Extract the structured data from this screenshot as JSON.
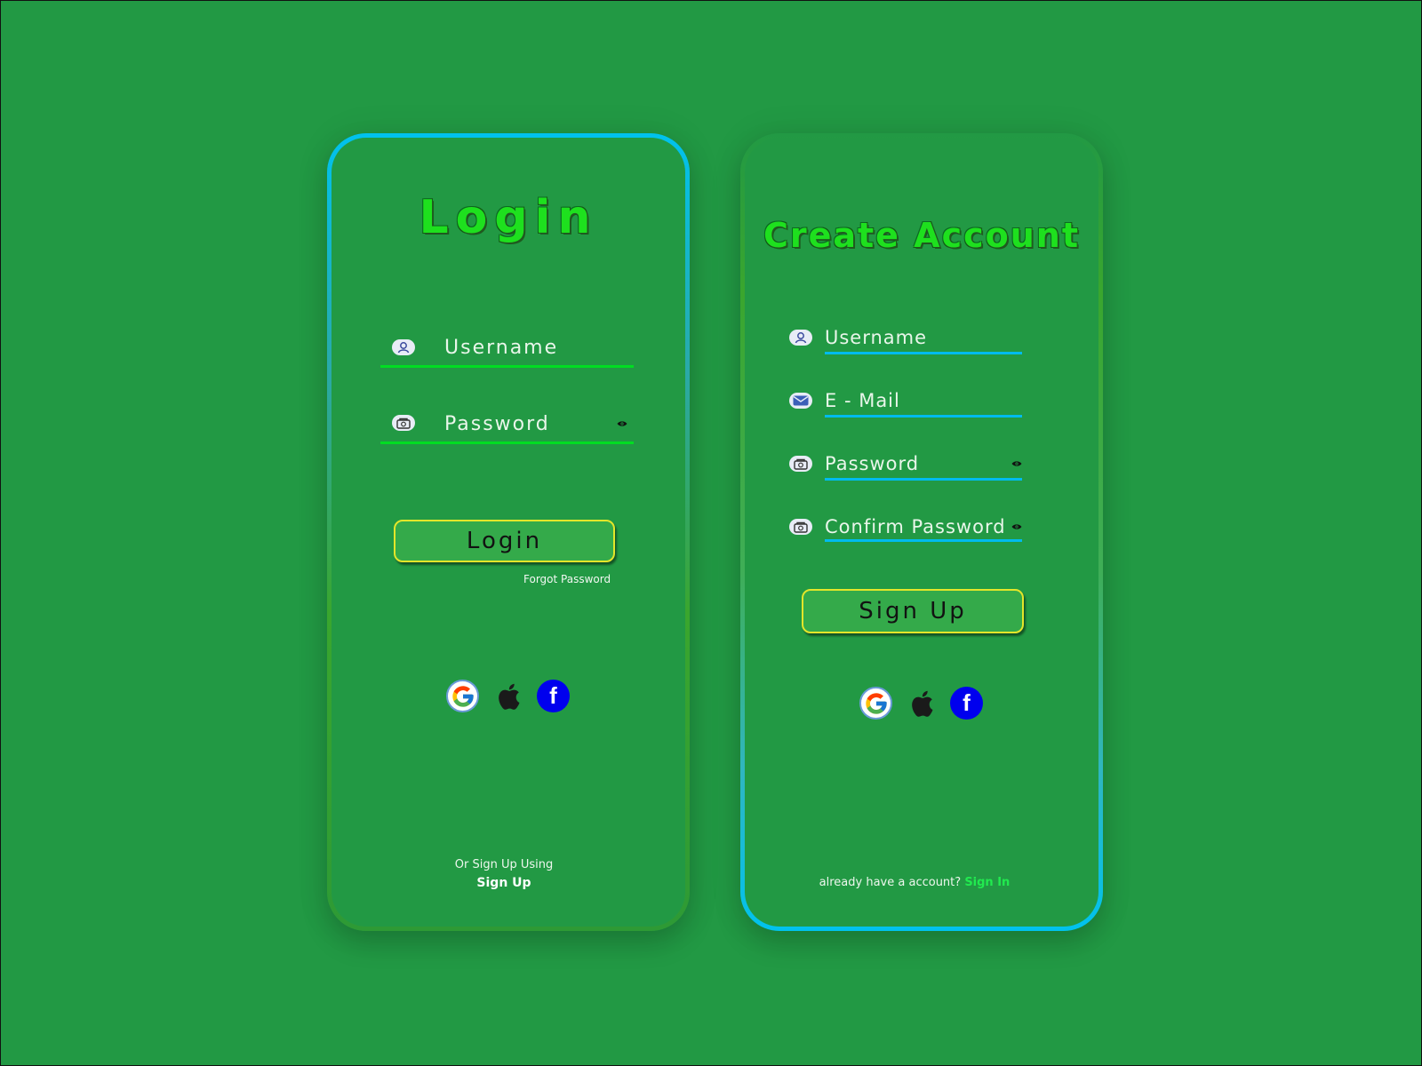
{
  "login": {
    "title": "Login",
    "username_placeholder": "Username",
    "password_placeholder": "Password",
    "button_label": "Login",
    "forgot_password": "Forgot Password",
    "or_signup_text": "Or Sign Up Using",
    "signup_link": "Sign Up",
    "socials": [
      "google-icon",
      "apple-icon",
      "facebook-icon"
    ]
  },
  "signup": {
    "title": "Create Account",
    "username_placeholder": "Username",
    "email_placeholder": "E - Mail",
    "password_placeholder": "Password",
    "confirm_password_placeholder": "Confirm Password",
    "button_label": "Sign Up",
    "already_text": "already have a account?",
    "signin_link": "Sign In",
    "socials": [
      "google-icon",
      "apple-icon",
      "facebook-icon"
    ]
  },
  "colors": {
    "background": "#229944",
    "login_underline": "#00dd22",
    "signup_underline": "#00bbee",
    "button_border": "#e3e62a",
    "facebook": "#0000ee",
    "signin_link": "#21ea4f"
  },
  "icons": {
    "facebook_glyph": "f"
  }
}
